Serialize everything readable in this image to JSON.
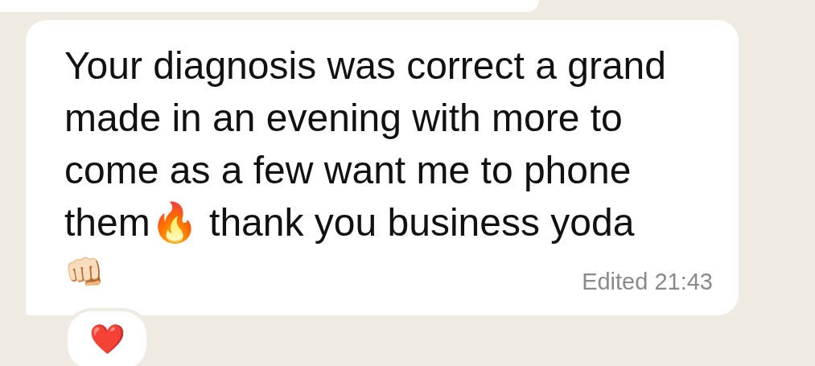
{
  "message": {
    "text": "Your diagnosis was correct a grand\nmade in an evening with more to\ncome as a few want me to phone\nthem🔥 thank you business yoda",
    "trailing_emoji": "👊🏻",
    "edited": true,
    "edited_label": "Edited",
    "time": "21:43",
    "reactions": [
      "❤️"
    ]
  }
}
